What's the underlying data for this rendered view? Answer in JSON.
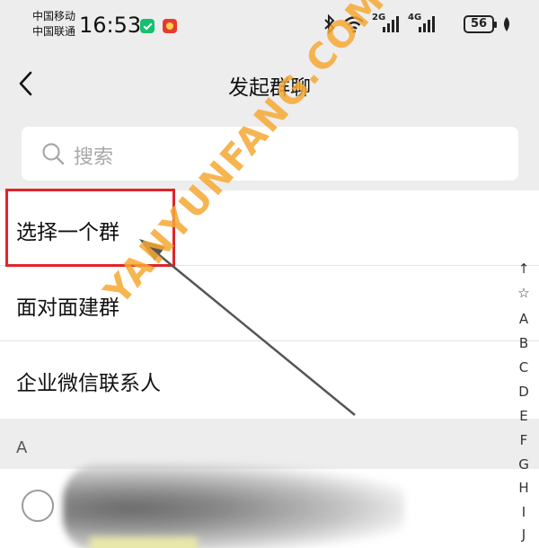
{
  "status_bar": {
    "carrier_line1": "中国移动",
    "carrier_line2": "中国联通",
    "time": "16:53",
    "signal1_label": "2G",
    "signal2_label": "4G",
    "battery": "56"
  },
  "nav": {
    "title": "发起群聊"
  },
  "search": {
    "placeholder": "搜索"
  },
  "list": [
    {
      "label": "选择一个群"
    },
    {
      "label": "面对面建群"
    },
    {
      "label": "企业微信联系人"
    }
  ],
  "section_letter": "A",
  "index": [
    "↑",
    "☆",
    "A",
    "B",
    "C",
    "D",
    "E",
    "F",
    "G",
    "H",
    "I",
    "J"
  ],
  "watermark": "YANYUNFANG.COM",
  "colors": {
    "highlight_border": "#e2242a",
    "watermark": "#f6a832",
    "background": "#ededed"
  }
}
